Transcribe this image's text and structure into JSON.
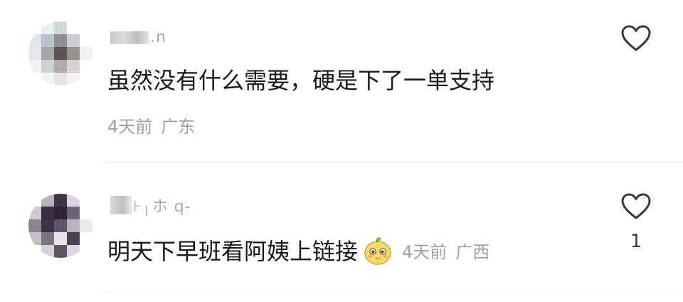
{
  "comments": [
    {
      "username_suffix": ".n",
      "text": "虽然没有什么需要，硬是下了一单支持",
      "time": "4天前",
      "location": "广东",
      "likes": ""
    },
    {
      "username_suffix": "⊦╷ホ q-",
      "text": "明天下早班看阿姨上链接",
      "time": "4天前",
      "location": "广西",
      "likes": "1",
      "emoji": "mascot-emoji"
    }
  ],
  "icons": {
    "like": "heart-outline-icon"
  },
  "colors": {
    "text": "#161823",
    "meta": "#a0a0a8",
    "icon": "#3a3a44"
  }
}
